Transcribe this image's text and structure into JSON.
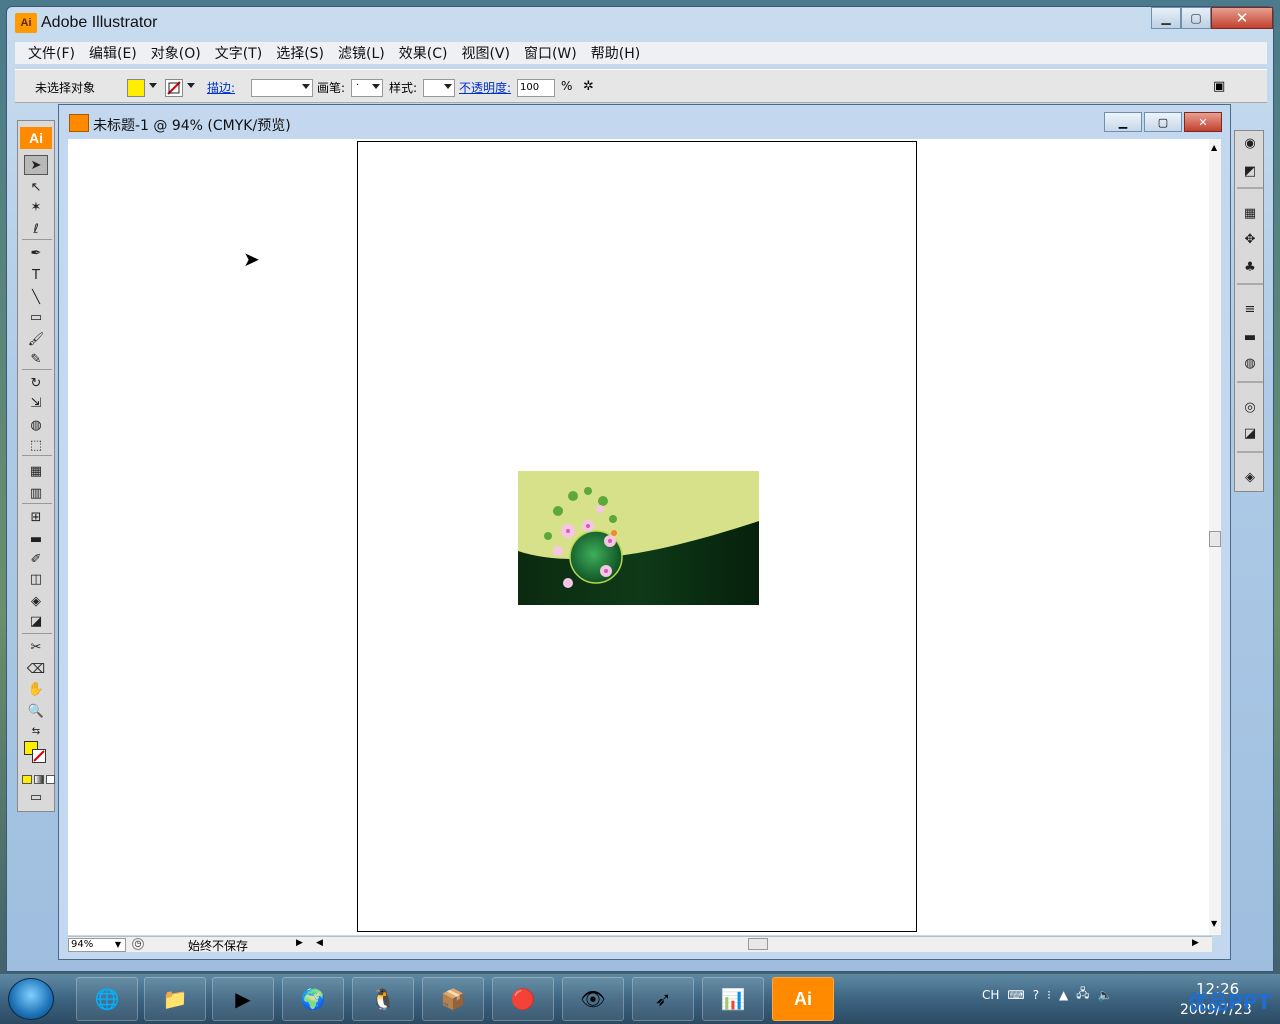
{
  "app": {
    "title": "Adobe Illustrator",
    "logo": "Ai"
  },
  "menu": [
    "文件(F)",
    "编辑(E)",
    "对象(O)",
    "文字(T)",
    "选择(S)",
    "滤镜(L)",
    "效果(C)",
    "视图(V)",
    "窗口(W)",
    "帮助(H)"
  ],
  "control": {
    "selection_label": "未选择对象",
    "stroke_label": "描边:",
    "brush_label": "画笔:",
    "brush_value": "·",
    "style_label": "样式:",
    "opacity_label": "不透明度:",
    "opacity_value": "100",
    "percent": "%",
    "fill_color": "#ffee00"
  },
  "toolbox": {
    "logo": "Ai"
  },
  "document": {
    "title": "未标题-1 @ 94% (CMYK/预览)",
    "zoom": "94%",
    "status": "始终不保存"
  },
  "taskbar": {
    "tray_lang": "CH",
    "time": "12:26",
    "date": "2009/7/23",
    "ai_label": "Ai",
    "watermark": "优品PPT"
  }
}
